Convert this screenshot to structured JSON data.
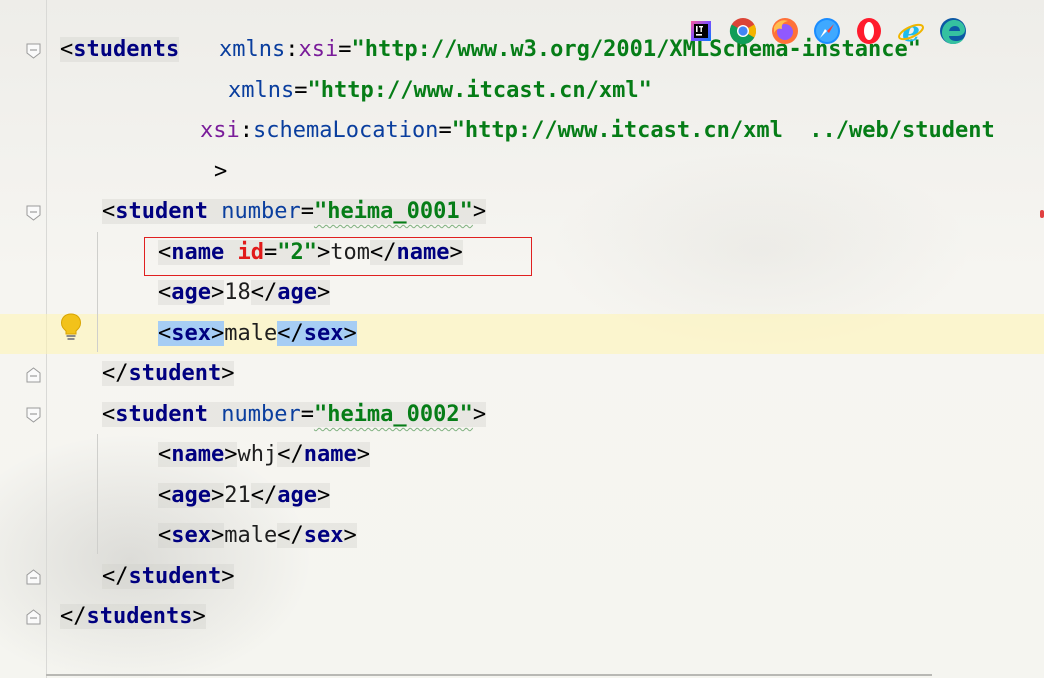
{
  "browser_toolbar": {
    "icons": [
      "intellij-icon",
      "chrome-icon",
      "firefox-icon",
      "safari-icon",
      "opera-icon",
      "ie-icon",
      "edge-icon"
    ]
  },
  "lines": [
    {
      "tokens": [
        {
          "t": "<",
          "c": "punc"
        },
        {
          "t": "students",
          "c": "tagc"
        },
        {
          "t": "   ",
          "c": "txt"
        },
        {
          "t": "xmlns",
          "c": "attr"
        },
        {
          "t": ":",
          "c": "punc"
        },
        {
          "t": "xsi",
          "c": "ns"
        },
        {
          "t": "=",
          "c": "punc"
        },
        {
          "t": "\"http://www.w3.org/2001/XMLSchema-instance\"",
          "c": "str"
        }
      ]
    },
    {
      "tokens": [
        {
          "t": "xmlns",
          "c": "attr"
        },
        {
          "t": "=",
          "c": "punc"
        },
        {
          "t": "\"http://www.itcast.cn/xml\"",
          "c": "str"
        }
      ]
    },
    {
      "tokens": [
        {
          "t": "xsi",
          "c": "ns"
        },
        {
          "t": ":",
          "c": "punc"
        },
        {
          "t": "schemaLocation",
          "c": "attr"
        },
        {
          "t": "=",
          "c": "punc"
        },
        {
          "t": "\"http://www.itcast.cn/xml  ../web/student",
          "c": "str"
        }
      ]
    },
    {
      "tokens": [
        {
          "t": ">",
          "c": "punc"
        }
      ]
    },
    {
      "tokens": [
        {
          "t": "<",
          "c": "punc"
        },
        {
          "t": "student",
          "c": "tagc"
        },
        {
          "t": " ",
          "c": "txt"
        },
        {
          "t": "number",
          "c": "attr"
        },
        {
          "t": "=",
          "c": "punc"
        },
        {
          "t": "\"heima_0001\"",
          "c": "str"
        },
        {
          "t": ">",
          "c": "punc"
        }
      ]
    },
    {
      "tokens": [
        {
          "t": "<",
          "c": "punc"
        },
        {
          "t": "name",
          "c": "tagc"
        },
        {
          "t": " ",
          "c": "txt"
        },
        {
          "t": "id",
          "c": "red"
        },
        {
          "t": "=",
          "c": "punc"
        },
        {
          "t": "\"2\"",
          "c": "str"
        },
        {
          "t": ">",
          "c": "punc"
        },
        {
          "t": "tom",
          "c": "txt"
        },
        {
          "t": "</",
          "c": "punc"
        },
        {
          "t": "name",
          "c": "tagc"
        },
        {
          "t": ">",
          "c": "punc"
        }
      ]
    },
    {
      "tokens": [
        {
          "t": "<",
          "c": "punc"
        },
        {
          "t": "age",
          "c": "tagc"
        },
        {
          "t": ">",
          "c": "punc"
        },
        {
          "t": "18",
          "c": "txt"
        },
        {
          "t": "</",
          "c": "punc"
        },
        {
          "t": "age",
          "c": "tagc"
        },
        {
          "t": ">",
          "c": "punc"
        }
      ]
    },
    {
      "tokens": [
        {
          "t": "<",
          "c": "punc"
        },
        {
          "t": "sex",
          "c": "tagc"
        },
        {
          "t": ">",
          "c": "punc"
        },
        {
          "t": "male",
          "c": "txt"
        },
        {
          "t": "</",
          "c": "punc"
        },
        {
          "t": "sex",
          "c": "tagc"
        },
        {
          "t": ">",
          "c": "punc"
        }
      ]
    },
    {
      "tokens": [
        {
          "t": "</",
          "c": "punc"
        },
        {
          "t": "student",
          "c": "tagc"
        },
        {
          "t": ">",
          "c": "punc"
        }
      ]
    },
    {
      "tokens": [
        {
          "t": "<",
          "c": "punc"
        },
        {
          "t": "student",
          "c": "tagc"
        },
        {
          "t": " ",
          "c": "txt"
        },
        {
          "t": "number",
          "c": "attr"
        },
        {
          "t": "=",
          "c": "punc"
        },
        {
          "t": "\"heima_0002\"",
          "c": "str"
        },
        {
          "t": ">",
          "c": "punc"
        }
      ]
    },
    {
      "tokens": [
        {
          "t": "<",
          "c": "punc"
        },
        {
          "t": "name",
          "c": "tagc"
        },
        {
          "t": ">",
          "c": "punc"
        },
        {
          "t": "whj",
          "c": "txt"
        },
        {
          "t": "</",
          "c": "punc"
        },
        {
          "t": "name",
          "c": "tagc"
        },
        {
          "t": ">",
          "c": "punc"
        }
      ]
    },
    {
      "tokens": [
        {
          "t": "<",
          "c": "punc"
        },
        {
          "t": "age",
          "c": "tagc"
        },
        {
          "t": ">",
          "c": "punc"
        },
        {
          "t": "21",
          "c": "txt"
        },
        {
          "t": "</",
          "c": "punc"
        },
        {
          "t": "age",
          "c": "tagc"
        },
        {
          "t": ">",
          "c": "punc"
        }
      ]
    },
    {
      "tokens": [
        {
          "t": "<",
          "c": "punc"
        },
        {
          "t": "sex",
          "c": "tagc"
        },
        {
          "t": ">",
          "c": "punc"
        },
        {
          "t": "male",
          "c": "txt"
        },
        {
          "t": "</",
          "c": "punc"
        },
        {
          "t": "sex",
          "c": "tagc"
        },
        {
          "t": ">",
          "c": "punc"
        }
      ]
    },
    {
      "tokens": [
        {
          "t": "</",
          "c": "punc"
        },
        {
          "t": "student",
          "c": "tagc"
        },
        {
          "t": ">",
          "c": "punc"
        }
      ]
    },
    {
      "tokens": [
        {
          "t": "</",
          "c": "punc"
        },
        {
          "t": "students",
          "c": "tagc"
        },
        {
          "t": ">",
          "c": "punc"
        }
      ]
    }
  ],
  "colors": {
    "tag": "#000080",
    "attribute": "#0a3e9e",
    "namespace": "#7a1c9a",
    "string": "#067d17",
    "error_attr": "#e11b1b",
    "current_line": "#fff4b0",
    "selection": "#a6cdf4",
    "annotation_box": "#e02020"
  }
}
